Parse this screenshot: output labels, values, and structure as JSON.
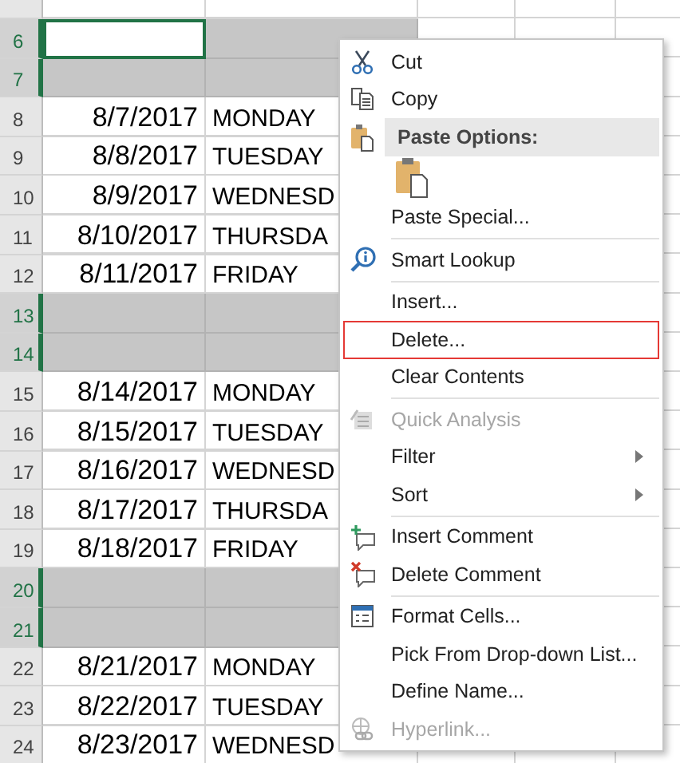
{
  "sheet": {
    "rows": [
      {
        "selected": false,
        "shaded": false
      },
      {
        "number": "6",
        "selected": true,
        "shaded": true,
        "active_cell": true
      },
      {
        "number": "7",
        "selected": true,
        "shaded": true
      },
      {
        "number": "8",
        "date": "8/7/2017",
        "day": "MONDAY",
        "selected": false,
        "shaded": false
      },
      {
        "number": "9",
        "date": "8/8/2017",
        "day": "TUESDAY",
        "selected": false,
        "shaded": false
      },
      {
        "number": "10",
        "date": "8/9/2017",
        "day": "WEDNESD",
        "selected": false,
        "shaded": false
      },
      {
        "number": "11",
        "date": "8/10/2017",
        "day": "THURSDA",
        "selected": false,
        "shaded": false
      },
      {
        "number": "12",
        "date": "8/11/2017",
        "day": "FRIDAY",
        "selected": false,
        "shaded": false
      },
      {
        "number": "13",
        "selected": true,
        "shaded": true
      },
      {
        "number": "14",
        "selected": true,
        "shaded": true
      },
      {
        "number": "15",
        "date": "8/14/2017",
        "day": "MONDAY",
        "selected": false,
        "shaded": false
      },
      {
        "number": "16",
        "date": "8/15/2017",
        "day": "TUESDAY",
        "selected": false,
        "shaded": false
      },
      {
        "number": "17",
        "date": "8/16/2017",
        "day": "WEDNESD",
        "selected": false,
        "shaded": false
      },
      {
        "number": "18",
        "date": "8/17/2017",
        "day": "THURSDA",
        "selected": false,
        "shaded": false
      },
      {
        "number": "19",
        "date": "8/18/2017",
        "day": "FRIDAY",
        "selected": false,
        "shaded": false
      },
      {
        "number": "20",
        "selected": true,
        "shaded": true
      },
      {
        "number": "21",
        "selected": true,
        "shaded": true
      },
      {
        "number": "22",
        "date": "8/21/2017",
        "day": "MONDAY",
        "selected": false,
        "shaded": false
      },
      {
        "number": "23",
        "date": "8/22/2017",
        "day": "TUESDAY",
        "selected": false,
        "shaded": false
      },
      {
        "number": "24",
        "date": "8/23/2017",
        "day": "WEDNESD",
        "selected": false,
        "shaded": false
      }
    ]
  },
  "context_menu": {
    "items": [
      {
        "kind": "command",
        "label": "Cut",
        "disabled": false
      },
      {
        "kind": "command",
        "label": "Copy",
        "disabled": false
      },
      {
        "kind": "header",
        "label": "Paste Options:"
      },
      {
        "kind": "paste_icons"
      },
      {
        "kind": "command",
        "label": "Paste Special...",
        "disabled": false
      },
      {
        "kind": "separator"
      },
      {
        "kind": "command",
        "label": "Smart Lookup",
        "disabled": false
      },
      {
        "kind": "separator"
      },
      {
        "kind": "command",
        "label": "Insert...",
        "disabled": false
      },
      {
        "kind": "command",
        "label": "Delete...",
        "disabled": false,
        "outlined": true
      },
      {
        "kind": "command",
        "label": "Clear Contents",
        "disabled": false
      },
      {
        "kind": "separator"
      },
      {
        "kind": "command",
        "label": "Quick Analysis",
        "disabled": true
      },
      {
        "kind": "command",
        "label": "Filter",
        "disabled": false,
        "submenu": true
      },
      {
        "kind": "command",
        "label": "Sort",
        "disabled": false,
        "submenu": true
      },
      {
        "kind": "separator"
      },
      {
        "kind": "command",
        "label": "Insert Comment",
        "disabled": false
      },
      {
        "kind": "command",
        "label": "Delete Comment",
        "disabled": false
      },
      {
        "kind": "separator"
      },
      {
        "kind": "command",
        "label": "Format Cells...",
        "disabled": false
      },
      {
        "kind": "command",
        "label": "Pick From Drop-down List...",
        "disabled": false
      },
      {
        "kind": "command",
        "label": "Define Name...",
        "disabled": false
      },
      {
        "kind": "command",
        "label": "Hyperlink...",
        "disabled": true
      }
    ]
  }
}
